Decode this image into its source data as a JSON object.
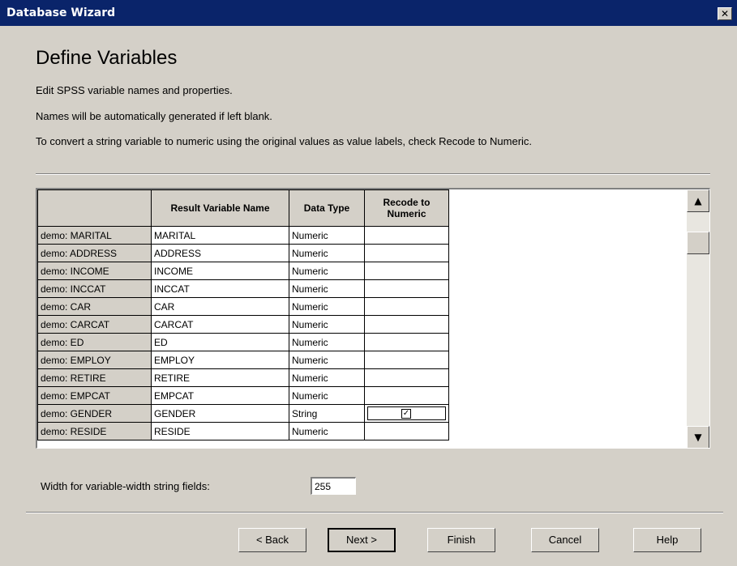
{
  "window": {
    "title": "Database Wizard",
    "close_glyph": "✕"
  },
  "page": {
    "heading": "Define Variables",
    "lines": [
      "Edit SPSS variable names and properties.",
      "Names will be automatically generated if left blank.",
      "To convert a string variable to numeric using the original values as value labels, check Recode to Numeric."
    ]
  },
  "table": {
    "headers": [
      "",
      "Result Variable Name",
      "Data Type",
      "Recode to Numeric"
    ],
    "rows": [
      {
        "source": "demo: MARITAL",
        "name": "MARITAL",
        "type": "Numeric",
        "recode": false
      },
      {
        "source": "demo: ADDRESS",
        "name": "ADDRESS",
        "type": "Numeric",
        "recode": false
      },
      {
        "source": "demo: INCOME",
        "name": "INCOME",
        "type": "Numeric",
        "recode": false
      },
      {
        "source": "demo: INCCAT",
        "name": "INCCAT",
        "type": "Numeric",
        "recode": false
      },
      {
        "source": "demo: CAR",
        "name": "CAR",
        "type": "Numeric",
        "recode": false
      },
      {
        "source": "demo: CARCAT",
        "name": "CARCAT",
        "type": "Numeric",
        "recode": false
      },
      {
        "source": "demo: ED",
        "name": "ED",
        "type": "Numeric",
        "recode": false
      },
      {
        "source": "demo: EMPLOY",
        "name": "EMPLOY",
        "type": "Numeric",
        "recode": false
      },
      {
        "source": "demo: RETIRE",
        "name": "RETIRE",
        "type": "Numeric",
        "recode": false
      },
      {
        "source": "demo: EMPCAT",
        "name": "EMPCAT",
        "type": "Numeric",
        "recode": false
      },
      {
        "source": "demo: GENDER",
        "name": "GENDER",
        "type": "String",
        "recode": true
      },
      {
        "source": "demo: RESIDE",
        "name": "RESIDE",
        "type": "Numeric",
        "recode": false
      }
    ]
  },
  "scrollbar": {
    "up_glyph": "▲",
    "down_glyph": "▼"
  },
  "width_field": {
    "label": "Width for variable-width string fields:",
    "value": "255"
  },
  "buttons": {
    "back": "< Back",
    "next": "Next >",
    "finish": "Finish",
    "cancel": "Cancel",
    "help": "Help"
  }
}
